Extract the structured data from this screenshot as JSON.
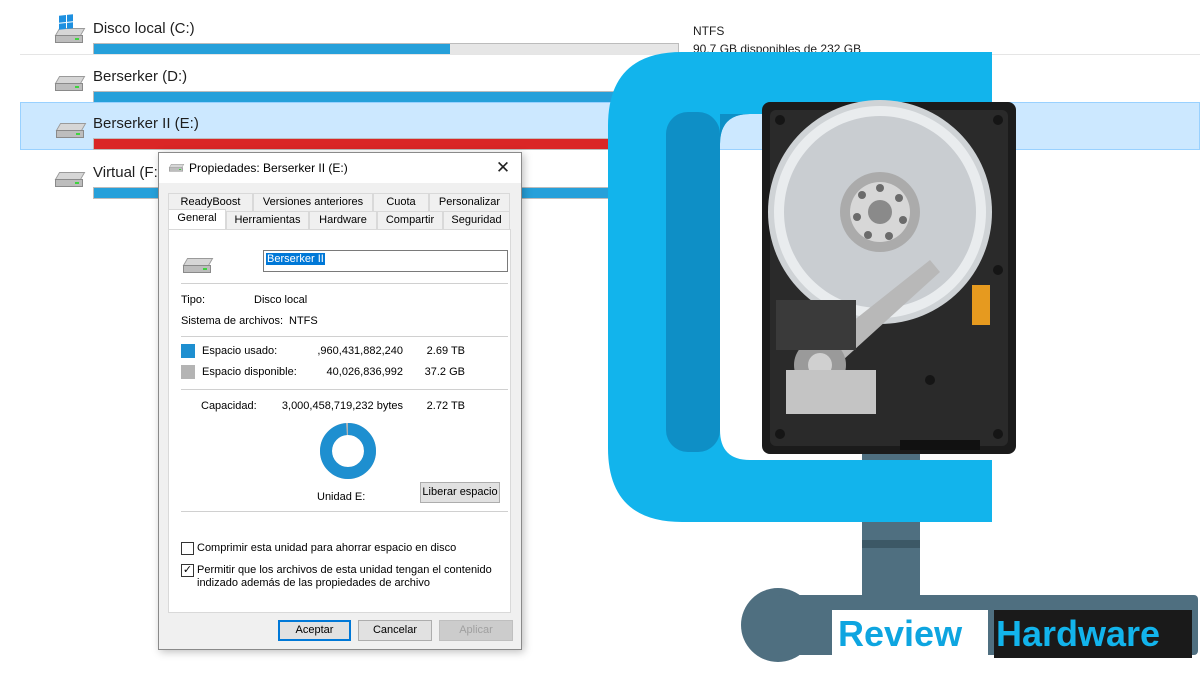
{
  "explorer": {
    "drives": [
      {
        "name": "Disco local (C:)",
        "used_fraction": 0.61,
        "bar_color": "#26a0da",
        "filesystem": "NTFS",
        "free_text": "90.7 GB disponibles de 232 GB",
        "icon": "windows-drive-icon"
      },
      {
        "name": "Berserker (D:)",
        "used_fraction": 1.0,
        "bar_color": "#26a0da",
        "icon": "hard-drive-icon"
      },
      {
        "name": "Berserker II (E:)",
        "used_fraction": 1.0,
        "bar_color": "#da2626",
        "icon": "hard-drive-icon",
        "selected": true
      },
      {
        "name": "Virtual (F:)",
        "used_fraction": 1.0,
        "bar_color": "#26a0da",
        "icon": "hard-drive-icon"
      }
    ]
  },
  "dialog": {
    "title": "Propiedades: Berserker II (E:)",
    "tabs_back": [
      "ReadyBoost",
      "Versiones anteriores",
      "Cuota",
      "Personalizar"
    ],
    "tabs_front": [
      "General",
      "Herramientas",
      "Hardware",
      "Compartir",
      "Seguridad"
    ],
    "active_tab": "General",
    "volume_name": "Berserker II",
    "type_label": "Tipo:",
    "type_value": "Disco local",
    "fs_label": "Sistema de archivos:",
    "fs_value": "NTFS",
    "used_label": "Espacio usado:",
    "used_bytes": ",960,431,882,240",
    "used_size": "2.69 TB",
    "used_color": "#1e8fd0",
    "free_label": "Espacio disponible:",
    "free_bytes": "40,026,836,992",
    "free_size": "37.2 GB",
    "free_color": "#b4b4b4",
    "capacity_label": "Capacidad:",
    "capacity_bytes": "3,000,458,719,232 bytes",
    "capacity_size": "2.72 TB",
    "drive_label": "Unidad E:",
    "cleanup_button": "Liberar espacio",
    "compress_label": "Comprimir esta unidad para ahorrar espacio en disco",
    "compress_checked": false,
    "index_label_line1": "Permitir que los archivos de esta unidad tengan el contenido",
    "index_label_line2": "indizado además de las propiedades de archivo",
    "index_checked": true,
    "ok_button": "Aceptar",
    "cancel_button": "Cancelar",
    "apply_button": "Aplicar",
    "used_fraction": 0.987
  },
  "brand": {
    "word1": "Review",
    "word2": "Hardware",
    "clamp_color": "#12b4ec",
    "clamp_dark": "#0e8fc6",
    "screw_color": "#4f6f80"
  }
}
